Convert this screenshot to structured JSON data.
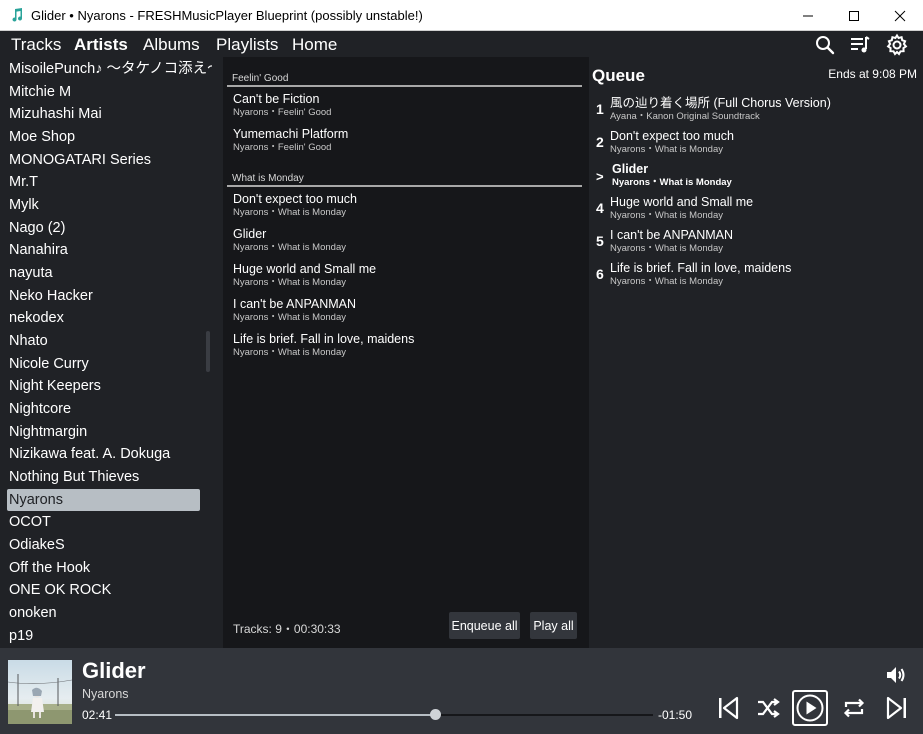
{
  "window": {
    "title": "Glider • Nyarons - FRESHMusicPlayer Blueprint (possibly unstable!)"
  },
  "nav": {
    "tabs": [
      {
        "label": "Tracks",
        "active": false
      },
      {
        "label": "Artists",
        "active": true
      },
      {
        "label": "Albums",
        "active": false
      },
      {
        "label": "Playlists",
        "active": false
      },
      {
        "label": "Home",
        "active": false
      }
    ],
    "icons": [
      "search-icon",
      "queue-icon",
      "settings-icon"
    ]
  },
  "artists": [
    "MisoilePunch♪ 〜タケノコ添え〜",
    "Mitchie M",
    "Mizuhashi Mai",
    "Moe Shop",
    "MONOGATARI Series",
    "Mr.T",
    "Mylk",
    "Nago (2)",
    "Nanahira",
    "nayuta",
    "Neko Hacker",
    "nekodex",
    "Nhato",
    "Nicole Curry",
    "Night Keepers",
    "Nightcore",
    "Nightmargin",
    "Nizikawa feat. A. Dokuga",
    "Nothing But Thieves",
    "Nyarons",
    "OCOT",
    "OdiakeS",
    "Off the Hook",
    "ONE OK ROCK",
    "onoken",
    "p19"
  ],
  "selected_artist": "Nyarons",
  "albums": [
    {
      "name": "Feelin' Good",
      "tracks": [
        {
          "title": "Can't be Fiction",
          "sub": "Nyarons・Feelin' Good"
        },
        {
          "title": "Yumemachi Platform",
          "sub": "Nyarons・Feelin' Good"
        }
      ]
    },
    {
      "name": "What is Monday",
      "tracks": [
        {
          "title": "Don't expect too much",
          "sub": "Nyarons・What is Monday"
        },
        {
          "title": "Glider",
          "sub": "Nyarons・What is Monday"
        },
        {
          "title": "Huge world and Small me",
          "sub": "Nyarons・What is Monday"
        },
        {
          "title": "I can't be ANPANMAN",
          "sub": "Nyarons・What is Monday"
        },
        {
          "title": "Life is brief. Fall in love, maidens",
          "sub": "Nyarons・What is Monday"
        }
      ]
    }
  ],
  "track_panel": {
    "summary": "Tracks: 9・00:30:33",
    "enqueue_label": "Enqueue all",
    "play_label": "Play all"
  },
  "queue": {
    "title": "Queue",
    "ends_at": "Ends at 9:08 PM",
    "items": [
      {
        "num": "1",
        "title": "風の辿り着く場所 (Full Chorus Version)",
        "sub": "Ayana・Kanon Original Soundtrack",
        "current": false
      },
      {
        "num": "2",
        "title": "Don't expect too much",
        "sub": "Nyarons・What is Monday",
        "current": false
      },
      {
        "num": ">",
        "title": "Glider",
        "sub": "Nyarons・What is Monday",
        "current": true
      },
      {
        "num": "4",
        "title": "Huge world and Small me",
        "sub": "Nyarons・What is Monday",
        "current": false
      },
      {
        "num": "5",
        "title": "I can't be ANPANMAN",
        "sub": "Nyarons・What is Monday",
        "current": false
      },
      {
        "num": "6",
        "title": "Life is brief. Fall in love, maidens",
        "sub": "Nyarons・What is Monday",
        "current": false
      }
    ]
  },
  "player": {
    "title": "Glider",
    "artist": "Nyarons",
    "elapsed": "02:41",
    "remaining": "-01:50",
    "progress": 0.594,
    "controls": [
      "volume-icon",
      "previous-icon",
      "shuffle-icon",
      "play-icon",
      "repeat-icon",
      "next-icon"
    ]
  },
  "colors": {
    "background": "#202226",
    "panel": "#16171a",
    "player_bar": "#32353b",
    "selection": "#b7bec4",
    "text": "#ffffff"
  }
}
